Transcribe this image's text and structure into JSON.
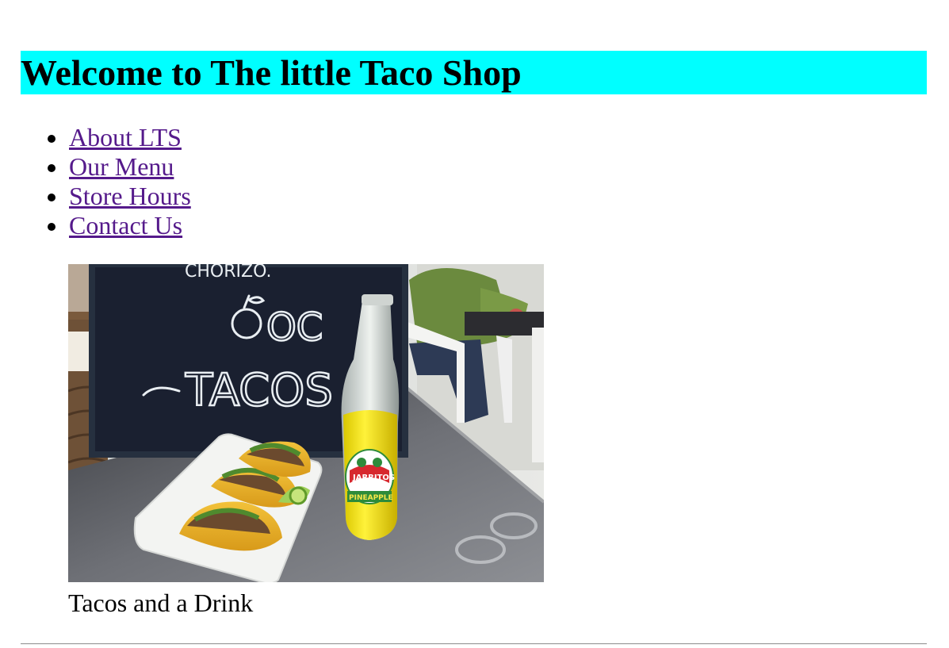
{
  "header": {
    "title": "Welcome to The little Taco Shop",
    "background": "#00ffff"
  },
  "nav": {
    "items": [
      {
        "label": "About LTS"
      },
      {
        "label": "Our Menu"
      },
      {
        "label": "Store Hours"
      },
      {
        "label": "Contact Us"
      }
    ],
    "link_color": "#551a8b"
  },
  "figure": {
    "image_alt": "Tacos and a Drink",
    "caption": "Tacos and a Drink",
    "chalkboard_text_1": "CHORIZO.",
    "chalkboard_text_2": "OC",
    "chalkboard_text_3": "TACOS",
    "bottle_brand": "JARRITOS",
    "bottle_flavor": "PINEAPPLE"
  }
}
